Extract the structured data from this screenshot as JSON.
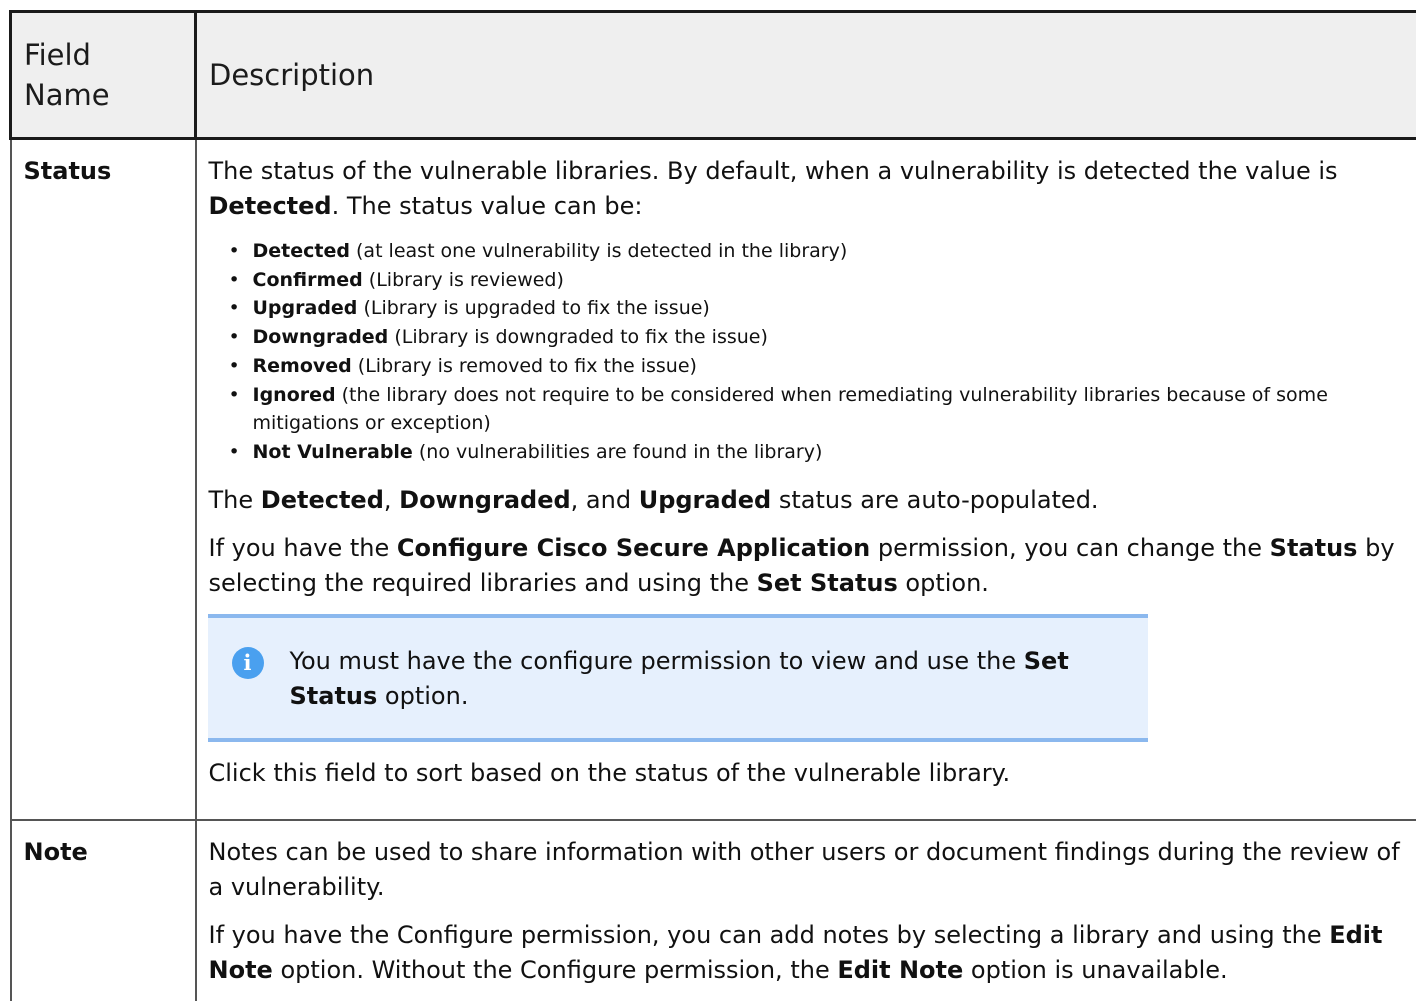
{
  "header": {
    "col1": "Field Name",
    "col1_line1": "Field",
    "col1_line2": "Name",
    "col2": "Description"
  },
  "status_row": {
    "field": "Status",
    "intro": {
      "t1": "The status of the vulnerable libraries. By default, when a vulnerability is detected the value is ",
      "b1": "Detected",
      "t2": ". The status value can be:"
    },
    "values": [
      {
        "name": "Detected",
        "desc": " (at least one vulnerability is detected in the library)"
      },
      {
        "name": "Confirmed",
        "desc": " (Library is reviewed)"
      },
      {
        "name": "Upgraded",
        "desc": " (Library is upgraded to fix the issue)"
      },
      {
        "name": "Downgraded",
        "desc": " (Library is downgraded to fix the issue)"
      },
      {
        "name": "Removed",
        "desc": " (Library is removed to fix the issue)"
      },
      {
        "name": "Ignored",
        "desc": " (the library does not require to be considered when remediating vulnerability libraries because of some mitigations or exception)"
      },
      {
        "name": "Not Vulnerable",
        "desc": " (no vulnerabilities are found in the library)"
      }
    ],
    "auto": {
      "t1": "The ",
      "b1": "Detected",
      "t2": ", ",
      "b2": "Downgraded",
      "t3": ", and ",
      "b3": "Upgraded",
      "t4": " status are auto-populated."
    },
    "perm": {
      "t1": "If you have the ",
      "b1": "Configure Cisco Secure Application",
      "t2": " permission, you can change the ",
      "b2": "Status",
      "t3": " by selecting the required libraries and using the ",
      "b3": "Set Status",
      "t4": " option."
    },
    "note": {
      "icon": "info-icon",
      "t1": "You must have the configure permission to view and use the ",
      "b1": "Set Status",
      "t2": " option."
    },
    "sort": "Click this field to sort based on the status of the vulnerable library."
  },
  "note_row": {
    "field": "Note",
    "p1": "Notes can be used to share information with other users or document findings during the review of a vulnerability.",
    "p2": {
      "t1": "If you have the Configure permission, you can add notes by selecting a library and using the ",
      "b1": "Edit Note",
      "t2": " option. Without the Configure permission, the ",
      "b2": "Edit Note",
      "t3": " option is unavailable."
    }
  }
}
